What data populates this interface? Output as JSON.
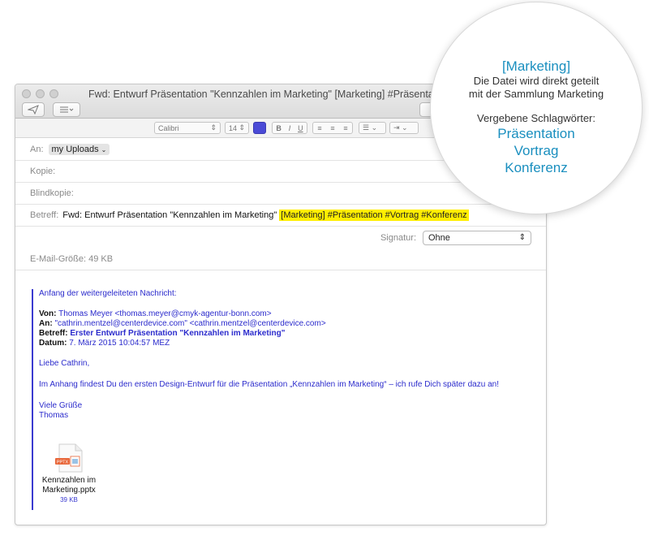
{
  "window": {
    "title": "Fwd: Entwurf Präsentation \"Kennzahlen im Marketing\" [Marketing] #Präsentation #Vortrag"
  },
  "format_bar": {
    "font": "Calibri",
    "size": "14",
    "bold": "B",
    "italic": "I",
    "underline": "U"
  },
  "headers": {
    "to_label": "An:",
    "to_value": "my Uploads",
    "cc_label": "Kopie:",
    "bcc_label": "Blindkopie:",
    "subject_label": "Betreff:",
    "subject_plain": "Fwd: Entwurf Präsentation \"Kennzahlen im Marketing\"",
    "subject_tags": "[Marketing] #Präsentation #Vortrag #Konferenz",
    "signature_label": "Signatur:",
    "signature_value": "Ohne",
    "size_label": "E-Mail-Größe: 49 KB"
  },
  "message": {
    "forward_intro": "Anfang der weitergeleiteten Nachricht:",
    "from_label": "Von:",
    "from_value": "Thomas Meyer <thomas.meyer@cmyk-agentur-bonn.com>",
    "to_label": "An:",
    "to_value": "\"cathrin.mentzel@centerdevice.com\" <cathrin.mentzel@centerdevice.com>",
    "subject_label": "Betreff:",
    "subject_value": "Erster Entwurf Präsentation \"Kennzahlen im Marketing\"",
    "date_label": "Datum:",
    "date_value": "7. März 2015 10:04:57 MEZ",
    "greeting": "Liebe Cathrin,",
    "body": "Im Anhang findest Du den ersten Design-Entwurf für die Präsentation „Kennzahlen im Marketing“ – ich rufe Dich später dazu an!",
    "closing": "Viele Grüße",
    "name": "Thomas",
    "attachment_name_1": "Kennzahlen im",
    "attachment_name_2": "Marketing.pptx",
    "attachment_size": "39 KB",
    "attachment_badge": "PPTX"
  },
  "popup": {
    "collection": "[Marketing]",
    "line1": "Die Datei wird direkt geteilt",
    "line2": "mit der Sammlung Marketing",
    "tags_heading": "Vergebene Schlagwörter:",
    "tag1": "Präsentation",
    "tag2": "Vortrag",
    "tag3": "Konferenz"
  },
  "colors": {
    "highlight": "#ffee00",
    "quote_blue": "#2b2bcc",
    "popup_cyan": "#1a8fbf"
  }
}
